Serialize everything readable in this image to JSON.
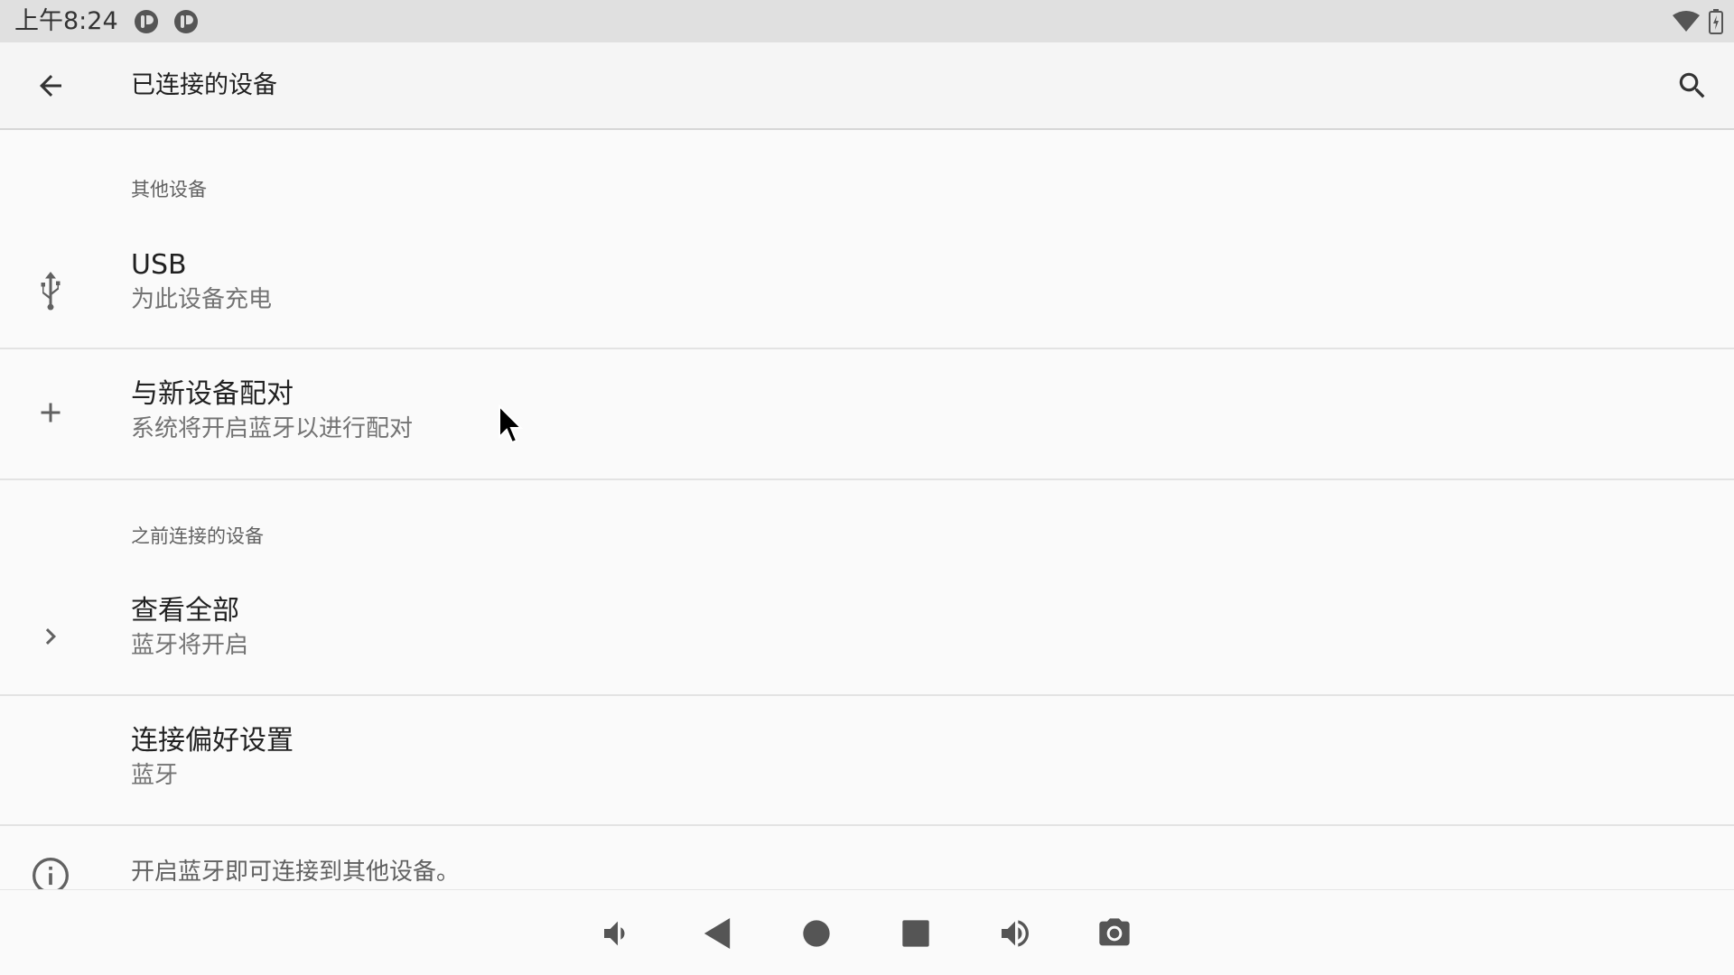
{
  "status_bar": {
    "time": "上午8:24",
    "icons": [
      "notification-app-icon",
      "notification-app-icon",
      "wifi-icon",
      "battery-charging-icon"
    ]
  },
  "app_bar": {
    "title": "已连接的设备",
    "back_icon": "arrow-back-icon",
    "search_icon": "search-icon"
  },
  "sections": {
    "other_devices": {
      "header": "其他设备",
      "items": [
        {
          "title": "USB",
          "summary": "为此设备充电",
          "icon": "usb-icon"
        },
        {
          "title": "与新设备配对",
          "summary": "系统将开启蓝牙以进行配对",
          "icon": "plus-icon"
        }
      ]
    },
    "previously_connected": {
      "header": "之前连接的设备",
      "items": [
        {
          "title": "查看全部",
          "summary": "蓝牙将开启",
          "icon": "chevron-right-icon"
        }
      ]
    },
    "preferences": {
      "title": "连接偏好设置",
      "summary": "蓝牙"
    }
  },
  "footer": {
    "text": "开启蓝牙即可连接到其他设备。",
    "icon": "info-icon"
  },
  "nav_bar": {
    "buttons": [
      "volume-down-icon",
      "back-triangle-icon",
      "home-circle-icon",
      "recents-square-icon",
      "volume-up-icon",
      "camera-icon"
    ]
  },
  "colors": {
    "status_bar_bg": "#e0e0e0",
    "app_bar_bg": "#f5f5f5",
    "page_bg": "#fafafa",
    "icon": "#616161",
    "nav_icon": "#555555"
  }
}
